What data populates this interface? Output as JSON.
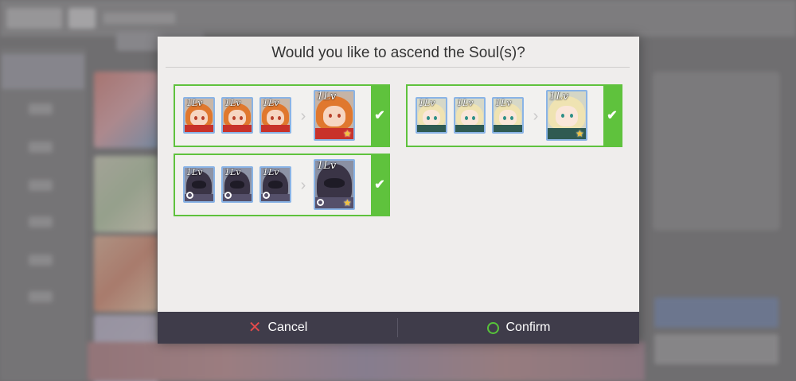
{
  "dialog": {
    "title": "Would you like to ascend the Soul(s)?",
    "cancel_label": "Cancel",
    "confirm_label": "Confirm"
  },
  "ascension_groups": [
    {
      "character": "orange-hair-girl",
      "material_levels": [
        "1Lv",
        "1Lv",
        "1Lv"
      ],
      "result_level": "1Lv",
      "selected": true
    },
    {
      "character": "blonde-hair-girl",
      "material_levels": [
        "1Lv",
        "1Lv",
        "1Lv"
      ],
      "result_level": "1Lv",
      "selected": true
    },
    {
      "character": "dark-armored-knight",
      "material_levels": [
        "1Lv",
        "1Lv",
        "1Lv"
      ],
      "result_level": "1Lv",
      "selected": true
    }
  ],
  "icons": {
    "check": "✔",
    "arrow": "›",
    "cancel": "✕",
    "star": "★"
  },
  "colors": {
    "selected_border": "#5fc23d",
    "frame_border": "#8ab4e6",
    "footer_bg": "#3f3c4a",
    "cancel_accent": "#e34b4b",
    "confirm_accent": "#57c43a"
  }
}
